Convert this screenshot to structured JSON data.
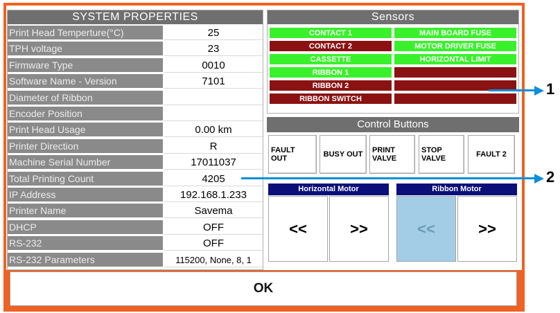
{
  "system_properties": {
    "title": "SYSTEM PROPERTIES",
    "rows": [
      {
        "label": "Print Head Temperture(°C)",
        "value": "25"
      },
      {
        "label": "TPH voltage",
        "value": "23"
      },
      {
        "label": "Firmware Type",
        "value": "0010"
      },
      {
        "label": "Software Name - Version",
        "value": "7101"
      },
      {
        "label": "Diameter of Ribbon",
        "value": ""
      },
      {
        "label": "Encoder Position",
        "value": ""
      },
      {
        "label": "Print Head Usage",
        "value": "0.00 km"
      },
      {
        "label": "Printer Direction",
        "value": "R"
      },
      {
        "label": "Machine Serial Number",
        "value": "17011037"
      },
      {
        "label": "Total Printing Count",
        "value": "4205"
      },
      {
        "label": "IP Address",
        "value": "192.168.1.233"
      },
      {
        "label": "Printer Name",
        "value": "Savema"
      },
      {
        "label": "DHCP",
        "value": "OFF"
      },
      {
        "label": "RS-232",
        "value": "OFF"
      },
      {
        "label": "RS-232 Parameters",
        "value": "115200, None, 8, 1"
      }
    ]
  },
  "sensors": {
    "title": "Sensors",
    "left": [
      {
        "label": "CONTACT 1",
        "state": "green"
      },
      {
        "label": "CONTACT 2",
        "state": "red"
      },
      {
        "label": "CASSETTE",
        "state": "green"
      },
      {
        "label": "RIBBON 1",
        "state": "green"
      },
      {
        "label": "RIBBON 2",
        "state": "red"
      },
      {
        "label": "RIBBON SWITCH",
        "state": "red"
      }
    ],
    "right": [
      {
        "label": "MAIN BOARD FUSE",
        "state": "green"
      },
      {
        "label": "MOTOR DRIVER FUSE",
        "state": "green"
      },
      {
        "label": "HORIZONTAL LIMIT",
        "state": "green"
      },
      {
        "label": "",
        "state": "red"
      },
      {
        "label": "",
        "state": "red"
      },
      {
        "label": "",
        "state": "red"
      }
    ]
  },
  "control_buttons": {
    "title": "Control Buttons",
    "buttons": [
      "FAULT\nOUT",
      "BUSY OUT",
      "PRINT\nVALVE",
      "STOP\nVALVE",
      "FAULT 2"
    ]
  },
  "motors": {
    "horizontal": {
      "title": "Horizontal Motor",
      "left": "<<",
      "right": ">>"
    },
    "ribbon": {
      "title": "Ribbon Motor",
      "left": "<<",
      "right": ">>"
    }
  },
  "ok_label": "OK",
  "callouts": {
    "one": "1",
    "two": "2"
  },
  "colors": {
    "frame": "#ef6223",
    "sensor_on": "#39f12b",
    "sensor_off": "#8b1212",
    "motor_header": "#0a0f7a",
    "callout": "#0b8fd8"
  }
}
